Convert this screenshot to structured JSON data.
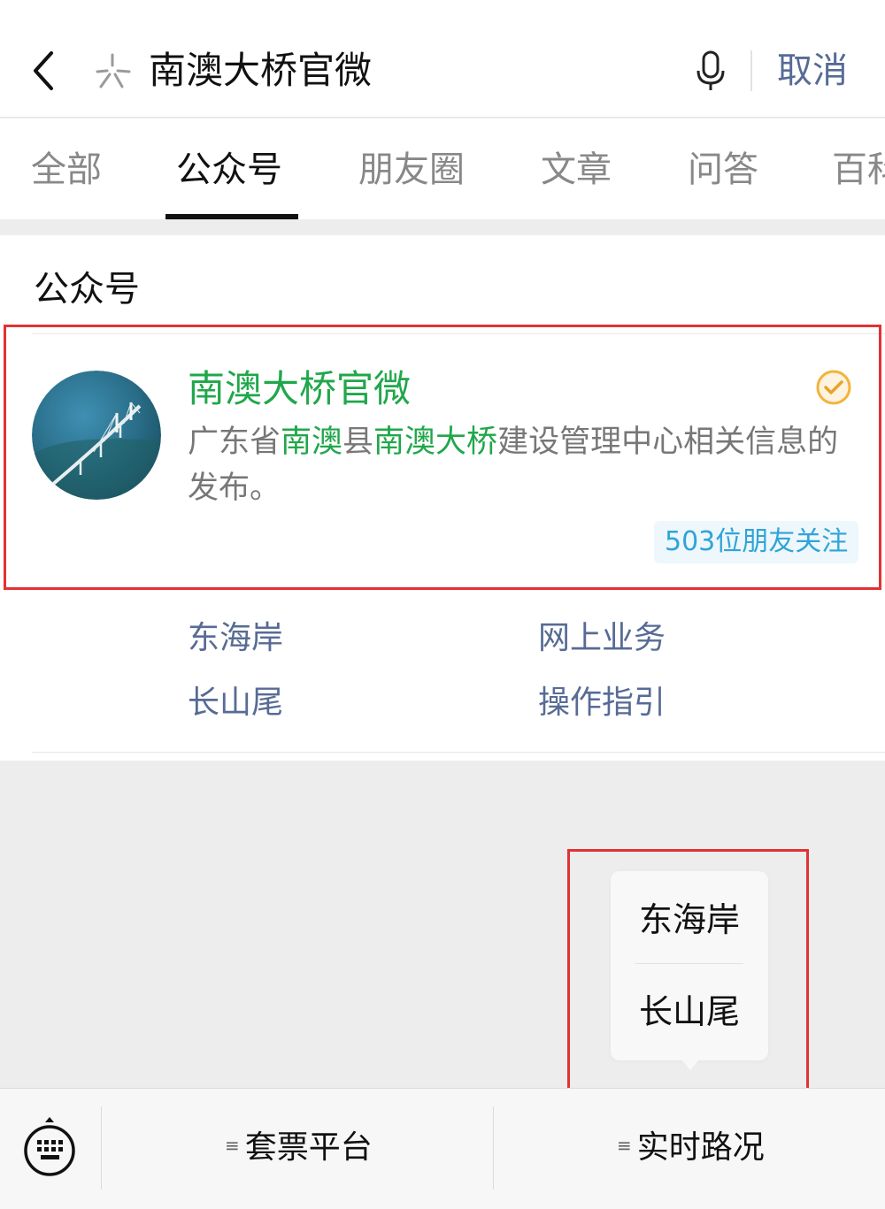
{
  "search": {
    "query": "南澳大桥官微",
    "cancel_label": "取消"
  },
  "tabs": [
    {
      "label": "全部"
    },
    {
      "label": "公众号"
    },
    {
      "label": "朋友圈"
    },
    {
      "label": "文章"
    },
    {
      "label": "问答"
    },
    {
      "label": "百科"
    }
  ],
  "section": {
    "title": "公众号"
  },
  "result": {
    "name": "南澳大桥官微",
    "description_parts": {
      "p1": "广东省",
      "p2": "南澳",
      "p3": "县",
      "p4": "南澳大桥",
      "p5": "建设管理中心相关信息的发布。"
    },
    "followers": "503位朋友关注",
    "links": [
      "东海岸",
      "网上业务",
      "长山尾",
      "操作指引"
    ]
  },
  "popup_menu": {
    "items": [
      "东海岸",
      "长山尾"
    ]
  },
  "bottom_menu": {
    "items": [
      "套票平台",
      "实时路况"
    ]
  },
  "colors": {
    "highlight_green": "#20a74b",
    "link_blue": "#576b95",
    "annotation_red": "#e23232",
    "badge_blue": "#2fa4d9"
  }
}
